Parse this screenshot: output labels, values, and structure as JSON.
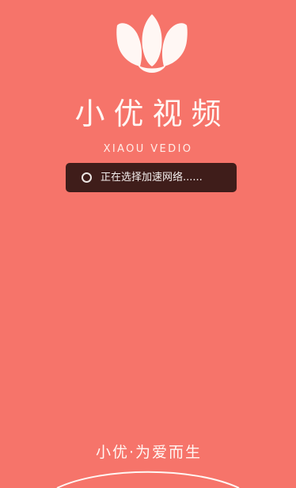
{
  "app": {
    "title": "小优视频",
    "subtitle": "XIAOU VEDIO",
    "logo_icon": "lotus-logo-icon"
  },
  "toast": {
    "spinner_icon": "loading-spinner-icon",
    "message": "正在选择加速网络......"
  },
  "footer": {
    "slogan": "小优·为爱而生"
  },
  "colors": {
    "background": "#F6746A",
    "foreground": "#FFF7F4",
    "toast_background": "#2B1412"
  }
}
